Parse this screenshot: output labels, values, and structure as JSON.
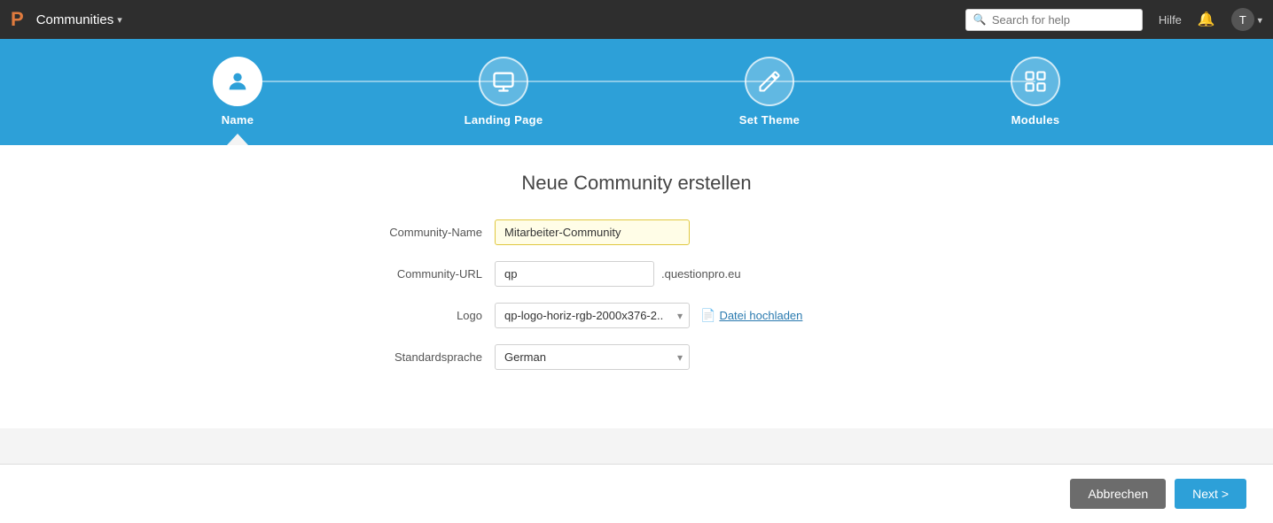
{
  "topnav": {
    "logo": "P",
    "brand": "Communities",
    "chevron": "▾",
    "search_placeholder": "Search for help",
    "hilfe": "Hilfe",
    "bell": "🔔",
    "user": "T"
  },
  "wizard": {
    "steps": [
      {
        "id": "name",
        "label": "Name",
        "icon": "👤",
        "active": true
      },
      {
        "id": "landing",
        "label": "Landing Page",
        "icon": "🖥",
        "active": false
      },
      {
        "id": "theme",
        "label": "Set Theme",
        "icon": "✏️",
        "active": false
      },
      {
        "id": "modules",
        "label": "Modules",
        "icon": "🧩",
        "active": false
      }
    ]
  },
  "form": {
    "title": "Neue Community erstellen",
    "fields": {
      "community_name_label": "Community-Name",
      "community_name_value": "Mitarbeiter-Community",
      "community_url_label": "Community-URL",
      "community_url_value": "qp",
      "community_url_suffix": ".questionpro.eu",
      "logo_label": "Logo",
      "logo_value": "qp-logo-horiz-rgb-2000x376-2....",
      "logo_upload": "Datei hochladen",
      "sprache_label": "Standardsprache",
      "sprache_value": "German"
    }
  },
  "footer": {
    "cancel_label": "Abbrechen",
    "next_label": "Next >"
  }
}
